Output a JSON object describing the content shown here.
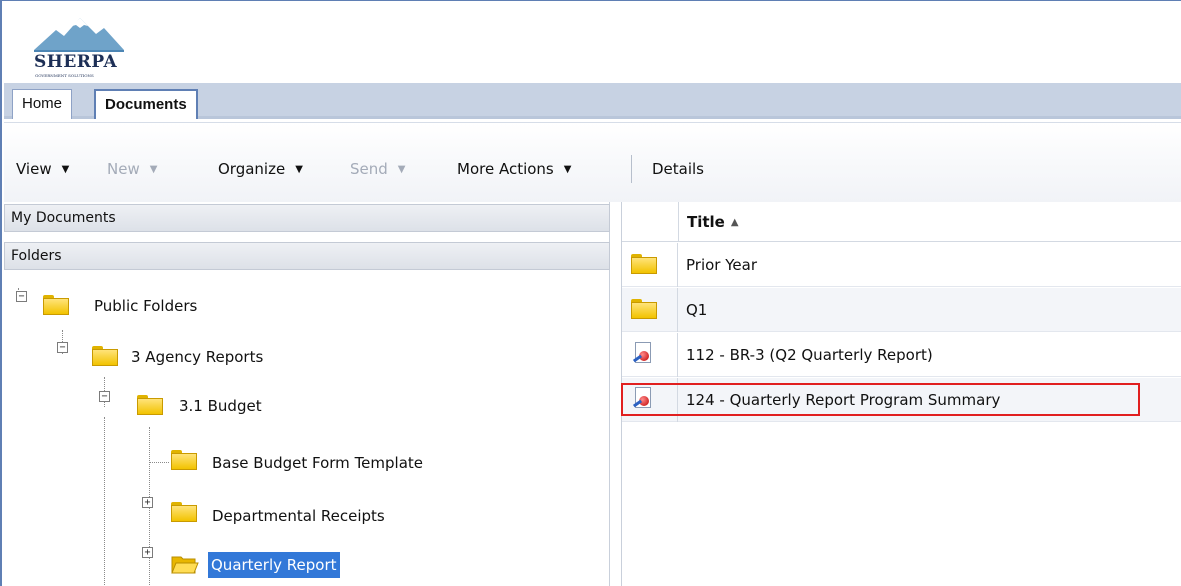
{
  "logo": {
    "name": "SHERPA",
    "tagline": "GOVERNMENT SOLUTIONS",
    "colors": {
      "mountain": "#6fa3c9",
      "text": "#1d2f56"
    }
  },
  "tabs": [
    {
      "label": "Home",
      "active": false
    },
    {
      "label": "Documents",
      "active": true
    }
  ],
  "toolbar": {
    "items": [
      {
        "label": "View",
        "enabled": true,
        "dropdown": true
      },
      {
        "label": "New",
        "enabled": false,
        "dropdown": true
      },
      {
        "label": "Organize",
        "enabled": true,
        "dropdown": true
      },
      {
        "label": "Send",
        "enabled": false,
        "dropdown": true
      },
      {
        "label": "More Actions",
        "enabled": true,
        "dropdown": true
      },
      {
        "label": "Details",
        "enabled": true,
        "dropdown": false
      }
    ],
    "dropdown_glyph": "▼"
  },
  "left_pane": {
    "my_documents_label": "My Documents",
    "folders_label": "Folders",
    "tree": [
      {
        "label": "Public Folders",
        "expander": "−",
        "icon": "folder-icon"
      },
      {
        "label": "3 Agency Reports",
        "expander": "−",
        "icon": "folder-icon"
      },
      {
        "label": "3.1 Budget",
        "expander": "−",
        "icon": "folder-icon"
      },
      {
        "label": "Base Budget Form Template",
        "expander": "",
        "icon": "folder-icon"
      },
      {
        "label": "Departmental Receipts",
        "expander": "+",
        "icon": "folder-icon"
      },
      {
        "label": "Quarterly Report",
        "expander": "+",
        "icon": "folder-open-icon",
        "selected": true
      }
    ]
  },
  "list": {
    "title_header": "Title",
    "sort_glyph": "▲",
    "rows": [
      {
        "title": "Prior Year",
        "icon": "folder-icon"
      },
      {
        "title": "Q1",
        "icon": "folder-icon"
      },
      {
        "title": "112 - BR-3 (Q2 Quarterly Report)",
        "icon": "pdf-document-icon"
      },
      {
        "title": "124 - Quarterly Report Program Summary",
        "icon": "pdf-document-icon",
        "highlighted": true
      }
    ]
  },
  "colors": {
    "selection": "#3278d8",
    "highlight_border": "#e11f1f",
    "tabbar": "#c7d2e3",
    "disabled_text": "#a4abb8"
  }
}
